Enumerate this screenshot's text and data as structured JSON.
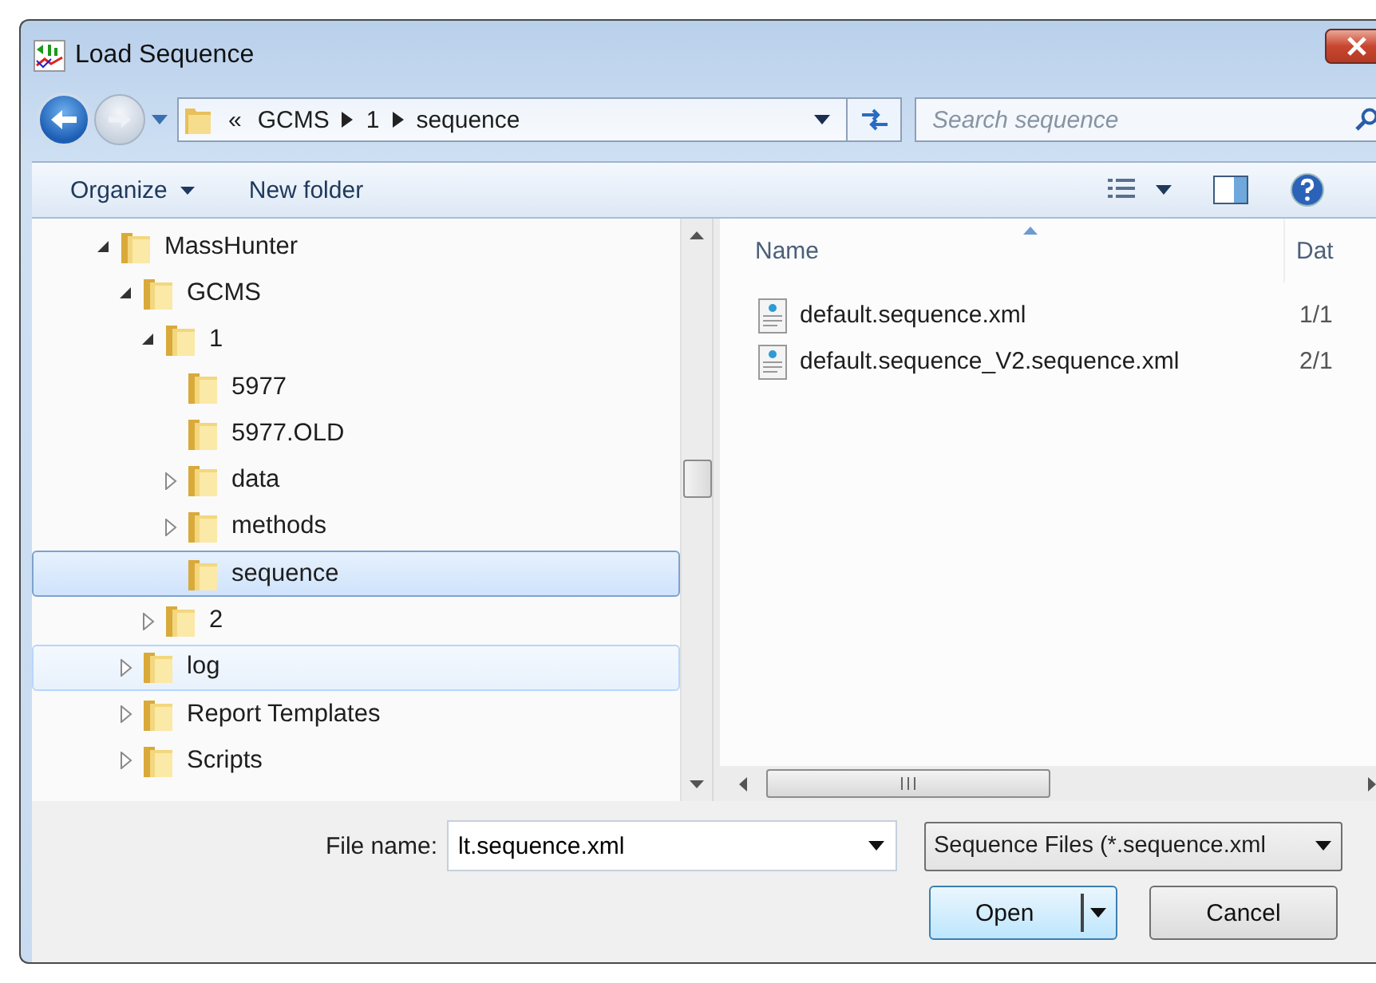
{
  "window": {
    "title": "Load Sequence"
  },
  "address": {
    "overflow": "«",
    "crumbs": [
      "GCMS",
      "1",
      "sequence"
    ]
  },
  "search": {
    "placeholder": "Search sequence"
  },
  "toolbar": {
    "organize": "Organize",
    "new_folder": "New folder"
  },
  "tree": [
    {
      "label": "MassHunter",
      "expanded": true,
      "selected": false,
      "hovered": false,
      "children": [
        {
          "label": "GCMS",
          "expanded": true,
          "selected": false,
          "hovered": false,
          "children": [
            {
              "label": "1",
              "expanded": true,
              "selected": false,
              "hovered": false,
              "children": [
                {
                  "label": "5977",
                  "selected": false,
                  "hovered": false
                },
                {
                  "label": "5977.OLD",
                  "selected": false,
                  "hovered": false
                },
                {
                  "label": "data",
                  "expanded": false,
                  "selected": false,
                  "hovered": false
                },
                {
                  "label": "methods",
                  "expanded": false,
                  "selected": false,
                  "hovered": false
                },
                {
                  "label": "sequence",
                  "selected": true,
                  "hovered": false
                }
              ]
            },
            {
              "label": "2",
              "expanded": false,
              "selected": false,
              "hovered": false
            }
          ]
        },
        {
          "label": "log",
          "expanded": false,
          "selected": false,
          "hovered": true
        },
        {
          "label": "Report Templates",
          "expanded": false,
          "selected": false,
          "hovered": false
        },
        {
          "label": "Scripts",
          "expanded": false,
          "selected": false,
          "hovered": false
        }
      ]
    }
  ],
  "files": {
    "columns": [
      "Name",
      "Dat"
    ],
    "rows": [
      {
        "name": "default.sequence.xml",
        "date": "1/1"
      },
      {
        "name": "default.sequence_V2.sequence.xml",
        "date": "2/1"
      }
    ]
  },
  "file_name": {
    "label": "File name:",
    "value": "lt.sequence.xml"
  },
  "file_type": {
    "value": "Sequence Files (*.sequence.xml"
  },
  "buttons": {
    "open": "Open",
    "cancel": "Cancel"
  }
}
